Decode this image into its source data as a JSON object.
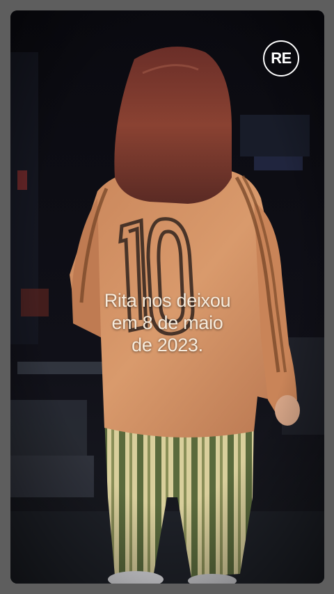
{
  "video": {
    "caption_lines": [
      "Rita nos deixou",
      "em 8 de maio",
      "de 2023."
    ],
    "logo_text": "RE"
  },
  "colors": {
    "frame": "#5e5e5e",
    "background": "#0c0c12",
    "shirt": "#d18f62",
    "hair": "#7e3a30",
    "caption": "#f6ebdc"
  }
}
